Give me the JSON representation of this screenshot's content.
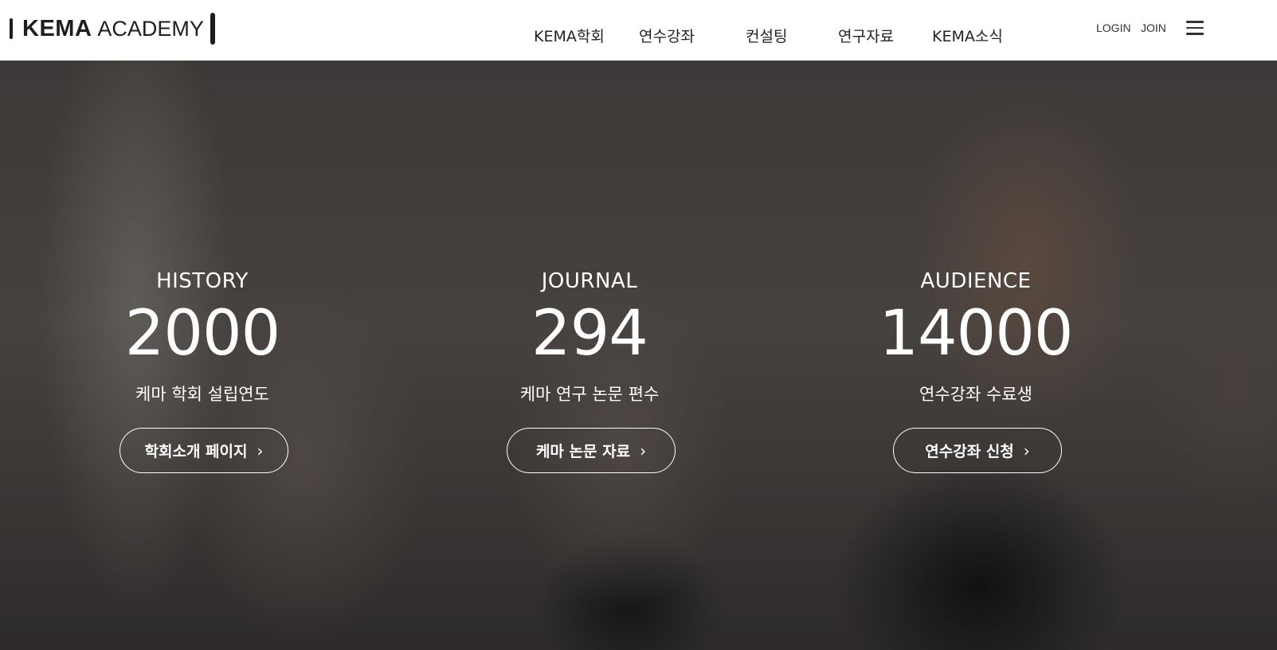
{
  "header": {
    "logo_bold": "KEMA",
    "logo_light": "ACADEMY",
    "nav": [
      "KEMA학회",
      "연수강좌",
      "컨설팅",
      "연구자료",
      "KEMA소식"
    ],
    "login_label": "LOGIN",
    "join_label": "JOIN",
    "menu_icon": "hamburger-icon"
  },
  "stats": [
    {
      "label": "HISTORY",
      "number": "2000",
      "desc": "케마 학회 설립연도",
      "button": "학회소개 페이지",
      "button_icon": "chevron-right-icon"
    },
    {
      "label": "JOURNAL",
      "number": "294",
      "desc": "케마 연구 논문 편수",
      "button": "케마 논문 자료",
      "button_icon": "chevron-right-icon"
    },
    {
      "label": "AUDIENCE",
      "number": "14000",
      "desc": "연수강좌 수료생",
      "button": "연수강좌 신청",
      "button_icon": "chevron-right-icon"
    }
  ],
  "colors": {
    "header_bg": "#ffffff",
    "text_dark": "#222222",
    "hero_text": "#ffffff"
  }
}
